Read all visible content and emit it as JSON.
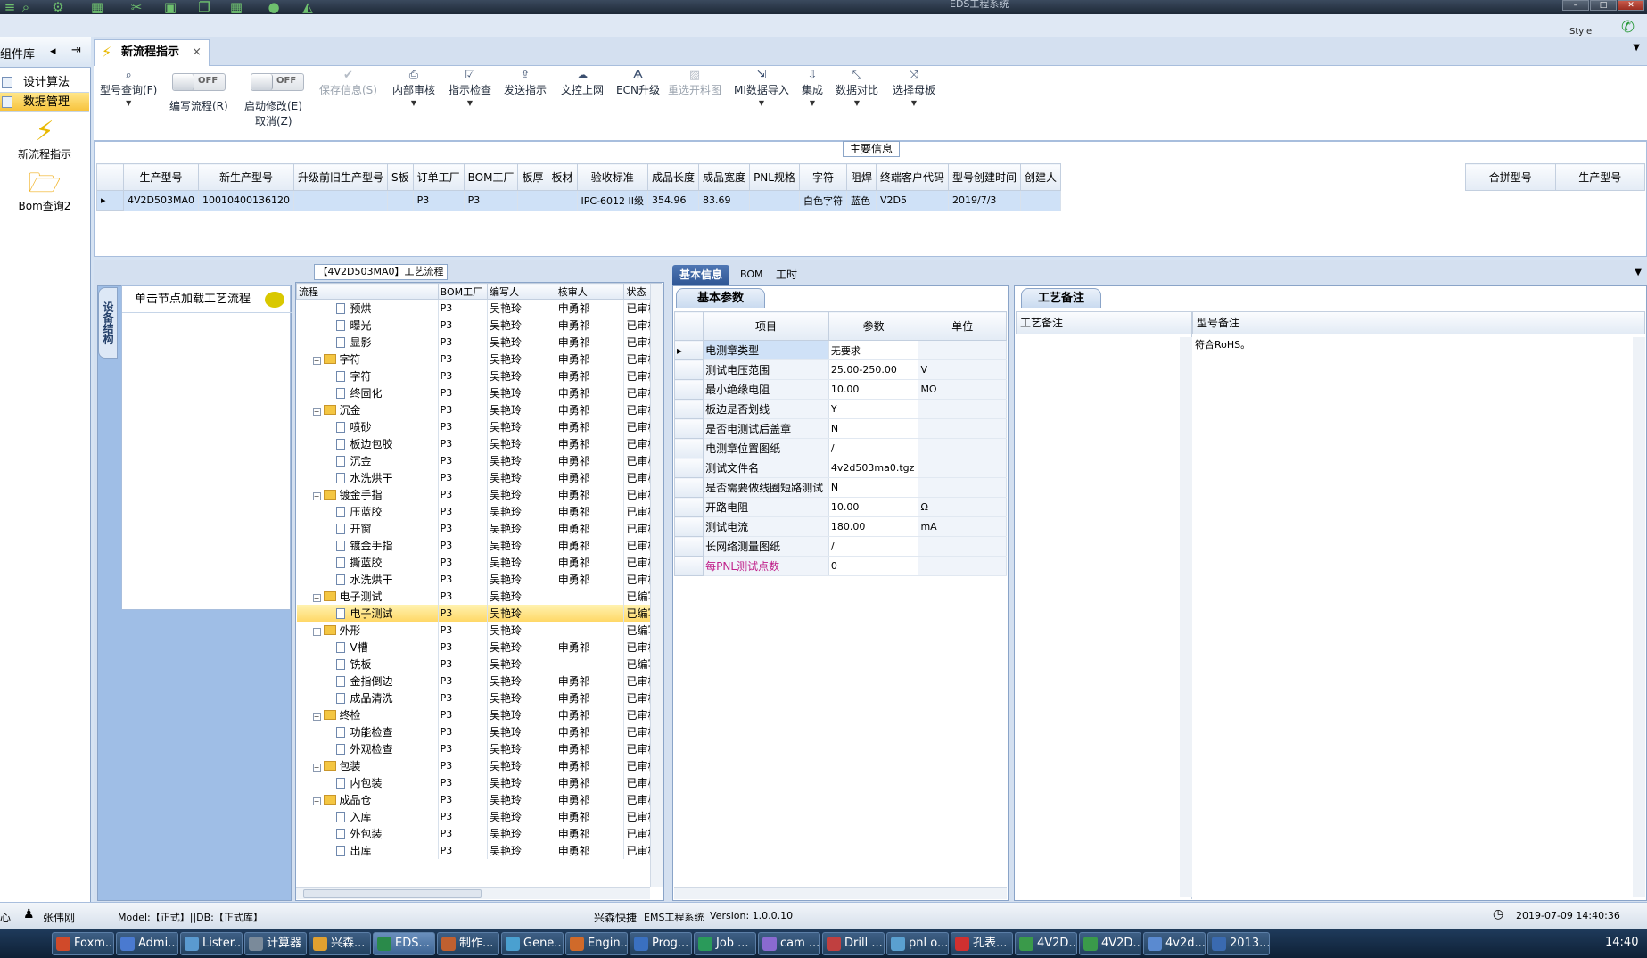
{
  "window": {
    "title": "EDS工程系统",
    "style_label": "Style"
  },
  "nav": {
    "header": "组件库",
    "items": [
      {
        "label": "设计算法"
      },
      {
        "label": "数据管理"
      }
    ],
    "launchers": [
      {
        "label": "新流程指示"
      },
      {
        "label": "Bom查询2"
      }
    ]
  },
  "tab": {
    "label": "新流程指示"
  },
  "toolbar": {
    "query": "型号查询(F)",
    "write_flow": "编写流程(R)",
    "start_modify": "启动修改(E)",
    "cancel": "取消(Z)",
    "toggle_off": "OFF",
    "buttons": [
      {
        "label": "保存信息(S)",
        "icon": "check-icon"
      },
      {
        "label": "内部审核",
        "icon": "print-icon"
      },
      {
        "label": "指示检查",
        "icon": "checkbox-icon"
      },
      {
        "label": "发送指示",
        "icon": "upload-icon"
      },
      {
        "label": "文控上网",
        "icon": "cloud-upload-icon"
      },
      {
        "label": "ECN升级",
        "icon": "ecn-icon"
      },
      {
        "label": "重选开料图",
        "icon": "image-icon"
      },
      {
        "label": "MI数据导入",
        "icon": "import-icon"
      },
      {
        "label": "集成",
        "icon": "download-icon"
      },
      {
        "label": "数据对比",
        "icon": "compare-icon"
      },
      {
        "label": "选择母板",
        "icon": "shuffle-icon"
      }
    ]
  },
  "main_info": {
    "title": "主要信息",
    "columns": [
      "生产型号",
      "新生产型号",
      "升级前旧生产型号",
      "S板",
      "订单工厂",
      "BOM工厂",
      "板厚",
      "板材",
      "验收标准",
      "成品长度",
      "成品宽度",
      "PNL规格",
      "字符",
      "阻焊",
      "终端客户代码",
      "型号创建时间",
      "创建人"
    ],
    "row": [
      "4V2D503MA0",
      "10010400136120",
      "",
      "",
      "P3",
      "P3",
      "",
      "",
      "IPC-6012 II级",
      "354.96",
      "83.69",
      "",
      "白色字符",
      "蓝色",
      "V2D5",
      "2019/7/3",
      ""
    ],
    "side_columns": [
      "合拼型号",
      "生产型号"
    ]
  },
  "left_panel": {
    "vtab": "设备结构",
    "hint": "单击节点加载工艺流程"
  },
  "tree": {
    "title": "【4V2D503MA0】工艺流程",
    "columns": [
      "流程",
      "BOM工厂",
      "编写人",
      "核审人",
      "状态"
    ],
    "rows": [
      {
        "label": "预烘",
        "level": 2,
        "folder": false,
        "factory": "P3",
        "writer": "吴艳玲",
        "reviewer": "申勇祁",
        "status": "已审核"
      },
      {
        "label": "曝光",
        "level": 2,
        "folder": false,
        "factory": "P3",
        "writer": "吴艳玲",
        "reviewer": "申勇祁",
        "status": "已审核"
      },
      {
        "label": "显影",
        "level": 2,
        "folder": false,
        "factory": "P3",
        "writer": "吴艳玲",
        "reviewer": "申勇祁",
        "status": "已审核"
      },
      {
        "label": "字符",
        "level": 1,
        "folder": true,
        "factory": "P3",
        "writer": "吴艳玲",
        "reviewer": "申勇祁",
        "status": "已审核"
      },
      {
        "label": "字符",
        "level": 2,
        "folder": false,
        "factory": "P3",
        "writer": "吴艳玲",
        "reviewer": "申勇祁",
        "status": "已审核"
      },
      {
        "label": "终固化",
        "level": 2,
        "folder": false,
        "factory": "P3",
        "writer": "吴艳玲",
        "reviewer": "申勇祁",
        "status": "已审核"
      },
      {
        "label": "沉金",
        "level": 1,
        "folder": true,
        "factory": "P3",
        "writer": "吴艳玲",
        "reviewer": "申勇祁",
        "status": "已审核"
      },
      {
        "label": "喷砂",
        "level": 2,
        "folder": false,
        "factory": "P3",
        "writer": "吴艳玲",
        "reviewer": "申勇祁",
        "status": "已审核"
      },
      {
        "label": "板边包胶",
        "level": 2,
        "folder": false,
        "factory": "P3",
        "writer": "吴艳玲",
        "reviewer": "申勇祁",
        "status": "已审核"
      },
      {
        "label": "沉金",
        "level": 2,
        "folder": false,
        "factory": "P3",
        "writer": "吴艳玲",
        "reviewer": "申勇祁",
        "status": "已审核"
      },
      {
        "label": "水洗烘干",
        "level": 2,
        "folder": false,
        "factory": "P3",
        "writer": "吴艳玲",
        "reviewer": "申勇祁",
        "status": "已审核"
      },
      {
        "label": "镀金手指",
        "level": 1,
        "folder": true,
        "factory": "P3",
        "writer": "吴艳玲",
        "reviewer": "申勇祁",
        "status": "已审核"
      },
      {
        "label": "压蓝胶",
        "level": 2,
        "folder": false,
        "factory": "P3",
        "writer": "吴艳玲",
        "reviewer": "申勇祁",
        "status": "已审核"
      },
      {
        "label": "开窗",
        "level": 2,
        "folder": false,
        "factory": "P3",
        "writer": "吴艳玲",
        "reviewer": "申勇祁",
        "status": "已审核"
      },
      {
        "label": "镀金手指",
        "level": 2,
        "folder": false,
        "factory": "P3",
        "writer": "吴艳玲",
        "reviewer": "申勇祁",
        "status": "已审核"
      },
      {
        "label": "撕蓝胶",
        "level": 2,
        "folder": false,
        "factory": "P3",
        "writer": "吴艳玲",
        "reviewer": "申勇祁",
        "status": "已审核"
      },
      {
        "label": "水洗烘干",
        "level": 2,
        "folder": false,
        "factory": "P3",
        "writer": "吴艳玲",
        "reviewer": "申勇祁",
        "status": "已审核"
      },
      {
        "label": "电子测试",
        "level": 1,
        "folder": true,
        "factory": "P3",
        "writer": "吴艳玲",
        "reviewer": "",
        "status": "已编写"
      },
      {
        "label": "电子测试",
        "level": 2,
        "folder": false,
        "factory": "P3",
        "writer": "吴艳玲",
        "reviewer": "",
        "status": "已编写",
        "selected": true
      },
      {
        "label": "外形",
        "level": 1,
        "folder": true,
        "factory": "P3",
        "writer": "吴艳玲",
        "reviewer": "",
        "status": "已编写"
      },
      {
        "label": "V槽",
        "level": 2,
        "folder": false,
        "factory": "P3",
        "writer": "吴艳玲",
        "reviewer": "申勇祁",
        "status": "已审核"
      },
      {
        "label": "铣板",
        "level": 2,
        "folder": false,
        "factory": "P3",
        "writer": "吴艳玲",
        "reviewer": "",
        "status": "已编写"
      },
      {
        "label": "金指倒边",
        "level": 2,
        "folder": false,
        "factory": "P3",
        "writer": "吴艳玲",
        "reviewer": "申勇祁",
        "status": "已审核"
      },
      {
        "label": "成品清洗",
        "level": 2,
        "folder": false,
        "factory": "P3",
        "writer": "吴艳玲",
        "reviewer": "申勇祁",
        "status": "已审核"
      },
      {
        "label": "终检",
        "level": 1,
        "folder": true,
        "factory": "P3",
        "writer": "吴艳玲",
        "reviewer": "申勇祁",
        "status": "已审核"
      },
      {
        "label": "功能检查",
        "level": 2,
        "folder": false,
        "factory": "P3",
        "writer": "吴艳玲",
        "reviewer": "申勇祁",
        "status": "已审核"
      },
      {
        "label": "外观检查",
        "level": 2,
        "folder": false,
        "factory": "P3",
        "writer": "吴艳玲",
        "reviewer": "申勇祁",
        "status": "已审核"
      },
      {
        "label": "包装",
        "level": 1,
        "folder": true,
        "factory": "P3",
        "writer": "吴艳玲",
        "reviewer": "申勇祁",
        "status": "已审核"
      },
      {
        "label": "内包装",
        "level": 2,
        "folder": false,
        "factory": "P3",
        "writer": "吴艳玲",
        "reviewer": "申勇祁",
        "status": "已审核"
      },
      {
        "label": "成品仓",
        "level": 1,
        "folder": true,
        "factory": "P3",
        "writer": "吴艳玲",
        "reviewer": "申勇祁",
        "status": "已审核"
      },
      {
        "label": "入库",
        "level": 2,
        "folder": false,
        "factory": "P3",
        "writer": "吴艳玲",
        "reviewer": "申勇祁",
        "status": "已审核"
      },
      {
        "label": "外包装",
        "level": 2,
        "folder": false,
        "factory": "P3",
        "writer": "吴艳玲",
        "reviewer": "申勇祁",
        "status": "已审核"
      },
      {
        "label": "出库",
        "level": 2,
        "folder": false,
        "factory": "P3",
        "writer": "吴艳玲",
        "reviewer": "申勇祁",
        "status": "已审核"
      }
    ]
  },
  "right_tabs": [
    "基本信息",
    "BOM",
    "工时"
  ],
  "params": {
    "tab": "基本参数",
    "columns": [
      "项目",
      "参数",
      "单位"
    ],
    "rows": [
      {
        "item": "电测章类型",
        "value": "无要求",
        "unit": ""
      },
      {
        "item": "测试电压范围",
        "value": "25.00-250.00",
        "unit": "V"
      },
      {
        "item": "最小绝缘电阻",
        "value": "10.00",
        "unit": "MΩ"
      },
      {
        "item": "板边是否划线",
        "value": "Y",
        "unit": ""
      },
      {
        "item": "是否电测试后盖章",
        "value": "N",
        "unit": ""
      },
      {
        "item": "电测章位置图纸",
        "value": "/",
        "unit": ""
      },
      {
        "item": "测试文件名",
        "value": "4v2d503ma0.tgz",
        "unit": ""
      },
      {
        "item": "是否需要做线圈短路测试",
        "value": "N",
        "unit": ""
      },
      {
        "item": "开路电阻",
        "value": "10.00",
        "unit": "Ω"
      },
      {
        "item": "测试电流",
        "value": "180.00",
        "unit": "mA"
      },
      {
        "item": "长网络测量图纸",
        "value": "/",
        "unit": ""
      },
      {
        "item": "每PNL测试点数",
        "value": "0",
        "unit": ""
      }
    ]
  },
  "notes": {
    "tab": "工艺备注",
    "col1": "工艺备注",
    "col2": "型号备注",
    "model_note": "符合RoHS。"
  },
  "status": {
    "center_suffix": "心",
    "user": "张伟刚",
    "model": "Model:【正式】||DB:【正式库】",
    "company": "兴森快捷",
    "app": "EMS工程系统",
    "version": "Version: 1.0.0.10",
    "datetime": "2019-07-09 14:40:36"
  },
  "taskbar": {
    "items": [
      "Foxm...",
      "Admi...",
      "Lister...",
      "计算器",
      "兴森...",
      "EDS...",
      "制作...",
      "Gene...",
      "Engin...",
      "Prog...",
      "Job ...",
      "cam ...",
      "Drill ...",
      "pnl o...",
      "孔表...",
      "4V2D...",
      "4V2D...",
      "4v2d...",
      "2013..."
    ],
    "clock": "14:40"
  }
}
